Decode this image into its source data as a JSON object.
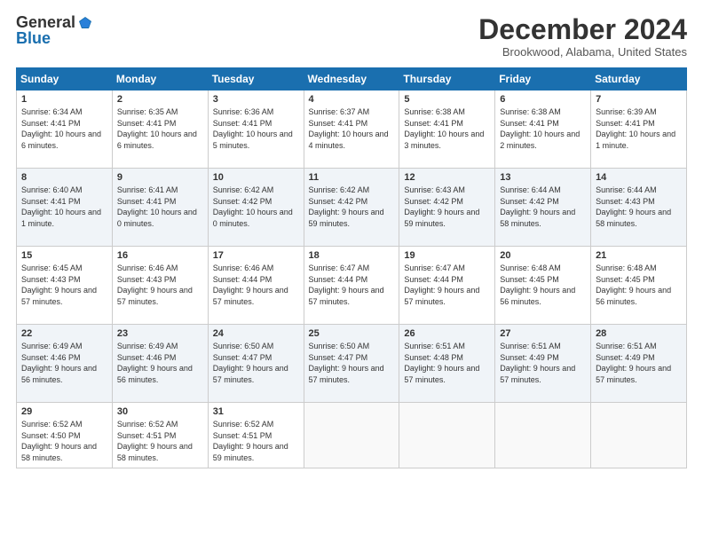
{
  "header": {
    "logo_general": "General",
    "logo_blue": "Blue",
    "month_title": "December 2024",
    "location": "Brookwood, Alabama, United States"
  },
  "weekdays": [
    "Sunday",
    "Monday",
    "Tuesday",
    "Wednesday",
    "Thursday",
    "Friday",
    "Saturday"
  ],
  "weeks": [
    [
      {
        "day": "1",
        "sunrise": "6:34 AM",
        "sunset": "4:41 PM",
        "daylight": "10 hours and 6 minutes."
      },
      {
        "day": "2",
        "sunrise": "6:35 AM",
        "sunset": "4:41 PM",
        "daylight": "10 hours and 6 minutes."
      },
      {
        "day": "3",
        "sunrise": "6:36 AM",
        "sunset": "4:41 PM",
        "daylight": "10 hours and 5 minutes."
      },
      {
        "day": "4",
        "sunrise": "6:37 AM",
        "sunset": "4:41 PM",
        "daylight": "10 hours and 4 minutes."
      },
      {
        "day": "5",
        "sunrise": "6:38 AM",
        "sunset": "4:41 PM",
        "daylight": "10 hours and 3 minutes."
      },
      {
        "day": "6",
        "sunrise": "6:38 AM",
        "sunset": "4:41 PM",
        "daylight": "10 hours and 2 minutes."
      },
      {
        "day": "7",
        "sunrise": "6:39 AM",
        "sunset": "4:41 PM",
        "daylight": "10 hours and 1 minute."
      }
    ],
    [
      {
        "day": "8",
        "sunrise": "6:40 AM",
        "sunset": "4:41 PM",
        "daylight": "10 hours and 1 minute."
      },
      {
        "day": "9",
        "sunrise": "6:41 AM",
        "sunset": "4:41 PM",
        "daylight": "10 hours and 0 minutes."
      },
      {
        "day": "10",
        "sunrise": "6:42 AM",
        "sunset": "4:42 PM",
        "daylight": "10 hours and 0 minutes."
      },
      {
        "day": "11",
        "sunrise": "6:42 AM",
        "sunset": "4:42 PM",
        "daylight": "9 hours and 59 minutes."
      },
      {
        "day": "12",
        "sunrise": "6:43 AM",
        "sunset": "4:42 PM",
        "daylight": "9 hours and 59 minutes."
      },
      {
        "day": "13",
        "sunrise": "6:44 AM",
        "sunset": "4:42 PM",
        "daylight": "9 hours and 58 minutes."
      },
      {
        "day": "14",
        "sunrise": "6:44 AM",
        "sunset": "4:43 PM",
        "daylight": "9 hours and 58 minutes."
      }
    ],
    [
      {
        "day": "15",
        "sunrise": "6:45 AM",
        "sunset": "4:43 PM",
        "daylight": "9 hours and 57 minutes."
      },
      {
        "day": "16",
        "sunrise": "6:46 AM",
        "sunset": "4:43 PM",
        "daylight": "9 hours and 57 minutes."
      },
      {
        "day": "17",
        "sunrise": "6:46 AM",
        "sunset": "4:44 PM",
        "daylight": "9 hours and 57 minutes."
      },
      {
        "day": "18",
        "sunrise": "6:47 AM",
        "sunset": "4:44 PM",
        "daylight": "9 hours and 57 minutes."
      },
      {
        "day": "19",
        "sunrise": "6:47 AM",
        "sunset": "4:44 PM",
        "daylight": "9 hours and 57 minutes."
      },
      {
        "day": "20",
        "sunrise": "6:48 AM",
        "sunset": "4:45 PM",
        "daylight": "9 hours and 56 minutes."
      },
      {
        "day": "21",
        "sunrise": "6:48 AM",
        "sunset": "4:45 PM",
        "daylight": "9 hours and 56 minutes."
      }
    ],
    [
      {
        "day": "22",
        "sunrise": "6:49 AM",
        "sunset": "4:46 PM",
        "daylight": "9 hours and 56 minutes."
      },
      {
        "day": "23",
        "sunrise": "6:49 AM",
        "sunset": "4:46 PM",
        "daylight": "9 hours and 56 minutes."
      },
      {
        "day": "24",
        "sunrise": "6:50 AM",
        "sunset": "4:47 PM",
        "daylight": "9 hours and 57 minutes."
      },
      {
        "day": "25",
        "sunrise": "6:50 AM",
        "sunset": "4:47 PM",
        "daylight": "9 hours and 57 minutes."
      },
      {
        "day": "26",
        "sunrise": "6:51 AM",
        "sunset": "4:48 PM",
        "daylight": "9 hours and 57 minutes."
      },
      {
        "day": "27",
        "sunrise": "6:51 AM",
        "sunset": "4:49 PM",
        "daylight": "9 hours and 57 minutes."
      },
      {
        "day": "28",
        "sunrise": "6:51 AM",
        "sunset": "4:49 PM",
        "daylight": "9 hours and 57 minutes."
      }
    ],
    [
      {
        "day": "29",
        "sunrise": "6:52 AM",
        "sunset": "4:50 PM",
        "daylight": "9 hours and 58 minutes."
      },
      {
        "day": "30",
        "sunrise": "6:52 AM",
        "sunset": "4:51 PM",
        "daylight": "9 hours and 58 minutes."
      },
      {
        "day": "31",
        "sunrise": "6:52 AM",
        "sunset": "4:51 PM",
        "daylight": "9 hours and 59 minutes."
      },
      null,
      null,
      null,
      null
    ]
  ],
  "labels": {
    "sunrise": "Sunrise:",
    "sunset": "Sunset:",
    "daylight": "Daylight:"
  }
}
